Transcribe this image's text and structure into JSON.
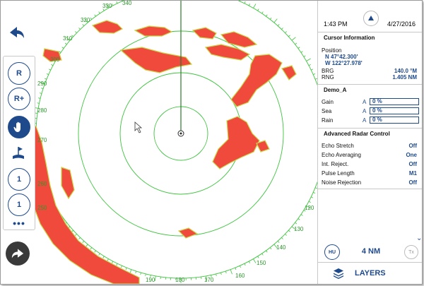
{
  "colors": {
    "ring": "#3cc43c",
    "echo_fill": "#f04a3c",
    "echo_edge": "#c9d44a",
    "accent": "#1e4a8c",
    "heading_line": "#2a7a2a"
  },
  "radar": {
    "bearing_ticks": [
      "330",
      "340",
      "320",
      "310",
      "300",
      "290",
      "280",
      "270",
      "260",
      "250",
      "120",
      "130",
      "140",
      "150",
      "160",
      "170",
      "180",
      "190"
    ],
    "center_icon": "own-vessel-icon"
  },
  "toolbar": {
    "back_icon": "back-arrow-icon",
    "forward_icon": "forward-arrow-icon",
    "tools": [
      {
        "name": "range-out-icon",
        "label": "R"
      },
      {
        "name": "range-in-icon",
        "label": "R+"
      },
      {
        "name": "pan-hand-icon",
        "label": ""
      },
      {
        "name": "mob-marker-icon",
        "label": ""
      },
      {
        "name": "ebl-icon",
        "label": "1"
      },
      {
        "name": "vrm-icon",
        "label": "1"
      }
    ],
    "more": "•••"
  },
  "panel": {
    "time": "1:43 PM",
    "date": "4/27/2016",
    "cursor_title": "Cursor Information",
    "position_label": "Position",
    "lat": "N 47°42.300'",
    "lon": "W 122°27.978'",
    "brg_label": "BRG",
    "brg_value": "140.0 °M",
    "rng_label": "RNG",
    "rng_value": "1.405 NM",
    "demo_title": "Demo_A",
    "controls": [
      {
        "label": "Gain",
        "mode": "A",
        "value": "0 %"
      },
      {
        "label": "Sea",
        "mode": "A",
        "value": "0 %"
      },
      {
        "label": "Rain",
        "mode": "A",
        "value": "0 %"
      }
    ],
    "adv_title": "Advanced Radar Control",
    "advanced": [
      {
        "label": "Echo Stretch",
        "value": "Off"
      },
      {
        "label": "Echo Averaging",
        "value": "One"
      },
      {
        "label": "Int. Reject.",
        "value": "Off"
      },
      {
        "label": "Pulse Length",
        "value": "M1"
      },
      {
        "label": "Noise Rejection",
        "value": "Off"
      }
    ]
  },
  "bottom": {
    "hu": "HU",
    "range": "4 NM",
    "tx": "Tx",
    "layers": "LAYERS"
  }
}
